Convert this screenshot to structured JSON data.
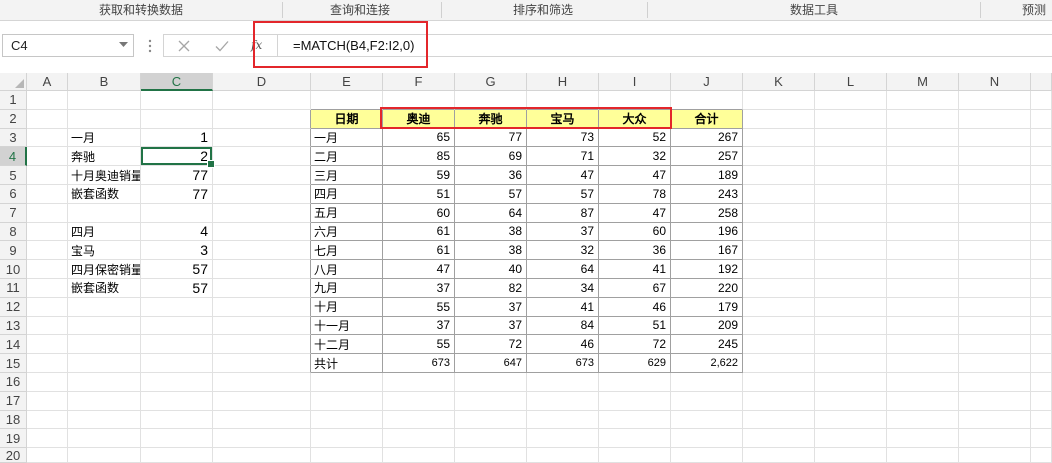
{
  "ribbon": {
    "groups": [
      {
        "label": "获取和转换数据"
      },
      {
        "label": "查询和连接"
      },
      {
        "label": "排序和筛选"
      },
      {
        "label": "数据工具"
      },
      {
        "label": "预测"
      }
    ]
  },
  "formula_bar": {
    "name_box": "C4",
    "name_box_icon": "chevron-down-icon",
    "grip_icon": "vertical-dots-icon",
    "cancel_icon": "close-icon",
    "enter_icon": "check-icon",
    "function_label": "fx",
    "formula": "=MATCH(B4,F2:I2,0)"
  },
  "sheet": {
    "columns": [
      "A",
      "B",
      "C",
      "D",
      "E",
      "F",
      "G",
      "H",
      "I",
      "J",
      "K",
      "L",
      "M",
      "N"
    ],
    "rows": [
      "1",
      "2",
      "3",
      "4",
      "5",
      "6",
      "7",
      "8",
      "9",
      "10",
      "11",
      "12",
      "13",
      "14",
      "15",
      "16",
      "17",
      "18",
      "19",
      "20"
    ],
    "cells": {
      "B3": "一月",
      "C3": "1",
      "B4": "奔驰",
      "C4": "2",
      "B5": "十月奥迪销量",
      "C5": "77",
      "B6": "嵌套函数",
      "C6": "77",
      "B8": "四月",
      "C8": "4",
      "B9": "宝马",
      "C9": "3",
      "B10": "四月保密销量",
      "C10": "57",
      "B11": "嵌套函数",
      "C11": "57",
      "E2": "日期",
      "F2": "奥迪",
      "G2": "奔驰",
      "H2": "宝马",
      "I2": "大众",
      "J2": "合计",
      "E3": "一月",
      "F3": "65",
      "G3": "77",
      "H3": "73",
      "I3": "52",
      "J3": "267",
      "E4": "二月",
      "F4": "85",
      "G4": "69",
      "H4": "71",
      "I4": "32",
      "J4": "257",
      "E5": "三月",
      "F5": "59",
      "G5": "36",
      "H5": "47",
      "I5": "47",
      "J5": "189",
      "E6": "四月",
      "F6": "51",
      "G6": "57",
      "H6": "57",
      "I6": "78",
      "J6": "243",
      "E7": "五月",
      "F7": "60",
      "G7": "64",
      "H7": "87",
      "I7": "47",
      "J7": "258",
      "E8": "六月",
      "F8": "61",
      "G8": "38",
      "H8": "37",
      "I8": "60",
      "J8": "196",
      "E9": "七月",
      "F9": "61",
      "G9": "38",
      "H9": "32",
      "I9": "36",
      "J9": "167",
      "E10": "八月",
      "F10": "47",
      "G10": "40",
      "H10": "64",
      "I10": "41",
      "J10": "192",
      "E11": "九月",
      "F11": "37",
      "G11": "82",
      "H11": "34",
      "I11": "67",
      "J11": "220",
      "E12": "十月",
      "F12": "55",
      "G12": "37",
      "H12": "41",
      "I12": "46",
      "J12": "179",
      "E13": "十一月",
      "F13": "37",
      "G13": "37",
      "H13": "84",
      "I13": "51",
      "J13": "209",
      "E14": "十二月",
      "F14": "55",
      "G14": "72",
      "H14": "46",
      "I14": "72",
      "J14": "245",
      "E15": "共计",
      "F15": "673",
      "G15": "647",
      "H15": "673",
      "I15": "629",
      "J15": "2,622"
    }
  },
  "colors": {
    "selection": "#217346",
    "header_fill": "#ffff99",
    "annotation_box": "#e3262b"
  }
}
